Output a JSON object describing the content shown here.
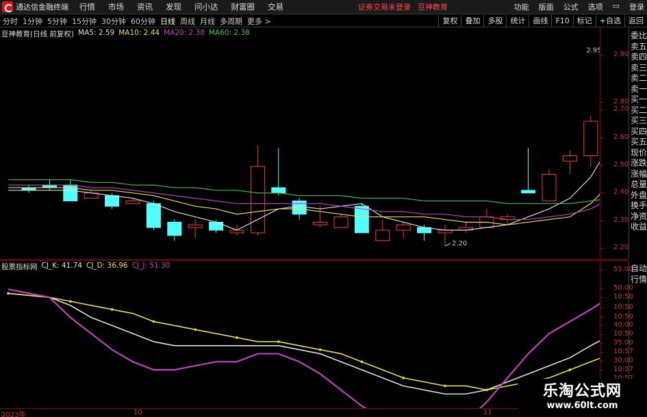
{
  "menubar": {
    "app_title": "通达信金融终端",
    "menus": [
      "行情",
      "市场",
      "资讯",
      "发现",
      "问小达",
      "财富圈",
      "交易"
    ],
    "notice": "证券交易未登录",
    "notice2": "豆神教育",
    "right_menus": [
      "功能",
      "版面",
      "公式",
      "选项",
      "",
      "登录"
    ]
  },
  "periodbar": {
    "periods": [
      "分时",
      "1分钟",
      "5分钟",
      "15分钟",
      "30分钟",
      "60分钟",
      "日线",
      "周线",
      "月线",
      "多周期",
      "更多 >"
    ],
    "active": "日线",
    "tools": [
      "复权",
      "叠加",
      "多股",
      "统计",
      "画线",
      "F10",
      "标记",
      "+自选",
      "返回"
    ]
  },
  "main_chart": {
    "title": "豆神教育(日线 前复权)",
    "ma": [
      {
        "label": "MA5: 2.59",
        "color": "#e0e0e0"
      },
      {
        "label": "MA10: 2.44",
        "color": "#e8e040"
      },
      {
        "label": "MA20: 2.38",
        "color": "#c040c0"
      },
      {
        "label": "MA60: 2.38",
        "color": "#40c040"
      }
    ],
    "high_label": "2.95",
    "low_label": "2.20",
    "price_ticks": [
      "2.90",
      "2.80",
      "2.70",
      "2.60",
      "2.50",
      "2.40",
      "2.30",
      "2.20"
    ]
  },
  "indicator": {
    "title": "股票指标网",
    "lines": [
      {
        "label": "CJ_K: 41.74",
        "color": "#e0e0e0"
      },
      {
        "label": "CJ_D: 36.96",
        "color": "#e8e040"
      },
      {
        "label": "CJ_J: 51.30",
        "color": "#c040c0"
      }
    ],
    "ticks": [
      "55.00",
      "50.00",
      "10:50",
      "10:50",
      "10:50",
      "40.00",
      "10:50",
      "35.00",
      "10:57",
      "30.00",
      "10:57",
      "10:57"
    ]
  },
  "dates": [
    "2023年",
    "10",
    "11"
  ],
  "sidebar_top": [
    "委比",
    "卖五",
    "卖四",
    "卖三",
    "卖二",
    "卖一",
    "买一",
    "买二",
    "买三",
    "买四",
    "买五",
    "现价",
    "涨跌",
    "涨幅",
    "总量",
    "外盘",
    "换手",
    "净资",
    "收益"
  ],
  "sidebar_bottom": [
    "自动",
    "行情"
  ],
  "watermark": {
    "line1": "乐淘公式网",
    "line2": "www.60lt.com"
  },
  "chart_data": {
    "type": "candlestick",
    "candles": [
      {
        "o": 2.42,
        "c": 2.41,
        "h": 2.43,
        "l": 2.4
      },
      {
        "o": 2.43,
        "c": 2.42,
        "h": 2.45,
        "l": 2.41
      },
      {
        "o": 2.43,
        "c": 2.37,
        "h": 2.45,
        "l": 2.37
      },
      {
        "o": 2.38,
        "c": 2.4,
        "h": 2.41,
        "l": 2.38
      },
      {
        "o": 2.39,
        "c": 2.35,
        "h": 2.4,
        "l": 2.34
      },
      {
        "o": 2.36,
        "c": 2.37,
        "h": 2.38,
        "l": 2.36
      },
      {
        "o": 2.36,
        "c": 2.27,
        "h": 2.37,
        "l": 2.26
      },
      {
        "o": 2.29,
        "c": 2.24,
        "h": 2.3,
        "l": 2.22
      },
      {
        "o": 2.27,
        "c": 2.28,
        "h": 2.3,
        "l": 2.23
      },
      {
        "o": 2.29,
        "c": 2.26,
        "h": 2.3,
        "l": 2.25
      },
      {
        "o": 2.25,
        "c": 2.26,
        "h": 2.28,
        "l": 2.24
      },
      {
        "o": 2.25,
        "c": 2.5,
        "h": 2.58,
        "l": 2.24
      },
      {
        "o": 2.42,
        "c": 2.4,
        "h": 2.57,
        "l": 2.39
      },
      {
        "o": 2.37,
        "c": 2.32,
        "h": 2.38,
        "l": 2.3
      },
      {
        "o": 2.28,
        "c": 2.29,
        "h": 2.35,
        "l": 2.27
      },
      {
        "o": 2.27,
        "c": 2.31,
        "h": 2.32,
        "l": 2.27
      },
      {
        "o": 2.35,
        "c": 2.25,
        "h": 2.36,
        "l": 2.25
      },
      {
        "o": 2.22,
        "c": 2.26,
        "h": 2.3,
        "l": 2.22
      },
      {
        "o": 2.26,
        "c": 2.28,
        "h": 2.29,
        "l": 2.23
      },
      {
        "o": 2.27,
        "c": 2.25,
        "h": 2.28,
        "l": 2.22
      },
      {
        "o": 2.25,
        "c": 2.26,
        "h": 2.28,
        "l": 2.2
      },
      {
        "o": 2.26,
        "c": 2.27,
        "h": 2.29,
        "l": 2.25
      },
      {
        "o": 2.27,
        "c": 2.31,
        "h": 2.34,
        "l": 2.27
      },
      {
        "o": 2.3,
        "c": 2.31,
        "h": 2.32,
        "l": 2.28
      },
      {
        "o": 2.41,
        "c": 2.4,
        "h": 2.57,
        "l": 2.4
      },
      {
        "o": 2.37,
        "c": 2.47,
        "h": 2.49,
        "l": 2.37
      },
      {
        "o": 2.52,
        "c": 2.54,
        "h": 2.56,
        "l": 2.47
      },
      {
        "o": 2.54,
        "c": 2.67,
        "h": 2.69,
        "l": 2.5
      },
      {
        "o": 2.68,
        "c": 2.85,
        "h": 2.95,
        "l": 2.68
      }
    ],
    "ma_series": [
      {
        "name": "MA5",
        "values": [
          2.41,
          2.41,
          2.41,
          2.4,
          2.39,
          2.38,
          2.36,
          2.33,
          2.31,
          2.29,
          2.26,
          2.3,
          2.34,
          2.35,
          2.34,
          2.35,
          2.36,
          2.31,
          2.29,
          2.27,
          2.26,
          2.26,
          2.27,
          2.28,
          2.31,
          2.34,
          2.38,
          2.46,
          2.59
        ]
      },
      {
        "name": "MA10",
        "values": [
          2.42,
          2.42,
          2.42,
          2.41,
          2.41,
          2.4,
          2.39,
          2.37,
          2.35,
          2.34,
          2.32,
          2.33,
          2.34,
          2.34,
          2.33,
          2.32,
          2.31,
          2.31,
          2.31,
          2.31,
          2.3,
          2.29,
          2.29,
          2.28,
          2.29,
          2.3,
          2.31,
          2.36,
          2.44
        ]
      },
      {
        "name": "MA20",
        "values": [
          2.43,
          2.43,
          2.43,
          2.42,
          2.42,
          2.41,
          2.4,
          2.39,
          2.38,
          2.37,
          2.36,
          2.36,
          2.36,
          2.36,
          2.36,
          2.35,
          2.34,
          2.33,
          2.33,
          2.32,
          2.32,
          2.31,
          2.31,
          2.3,
          2.3,
          2.31,
          2.32,
          2.34,
          2.38
        ]
      },
      {
        "name": "MA60",
        "values": [
          2.45,
          2.45,
          2.45,
          2.44,
          2.44,
          2.43,
          2.43,
          2.42,
          2.42,
          2.41,
          2.41,
          2.4,
          2.4,
          2.39,
          2.39,
          2.39,
          2.38,
          2.38,
          2.38,
          2.37,
          2.37,
          2.37,
          2.37,
          2.36,
          2.36,
          2.36,
          2.36,
          2.37,
          2.38
        ]
      }
    ],
    "ylim": [
      2.17,
      2.99
    ],
    "ind_series": [
      {
        "name": "CJ_K",
        "values": [
          52,
          51,
          49,
          46,
          44,
          42,
          40,
          39,
          39,
          39,
          39,
          39,
          39,
          38,
          37,
          35,
          33,
          31,
          29,
          28,
          27,
          27,
          28,
          30,
          32,
          34,
          36,
          39,
          41.74
        ]
      },
      {
        "name": "CJ_D",
        "values": [
          52,
          51,
          50,
          49,
          48,
          47,
          45,
          44,
          43,
          42,
          41,
          40,
          40,
          39,
          38,
          37,
          35,
          33,
          31,
          30,
          29,
          29,
          28,
          29,
          30,
          31,
          33,
          35,
          36.96
        ]
      },
      {
        "name": "CJ_J",
        "values": [
          53,
          51,
          46,
          42,
          38,
          35,
          33,
          33,
          34,
          35,
          35,
          37,
          37,
          35,
          32,
          28,
          24,
          21,
          19,
          18,
          18,
          20,
          25,
          31,
          37,
          42,
          45,
          48,
          51.3
        ]
      }
    ],
    "ind_ylim": [
      24,
      57
    ]
  }
}
